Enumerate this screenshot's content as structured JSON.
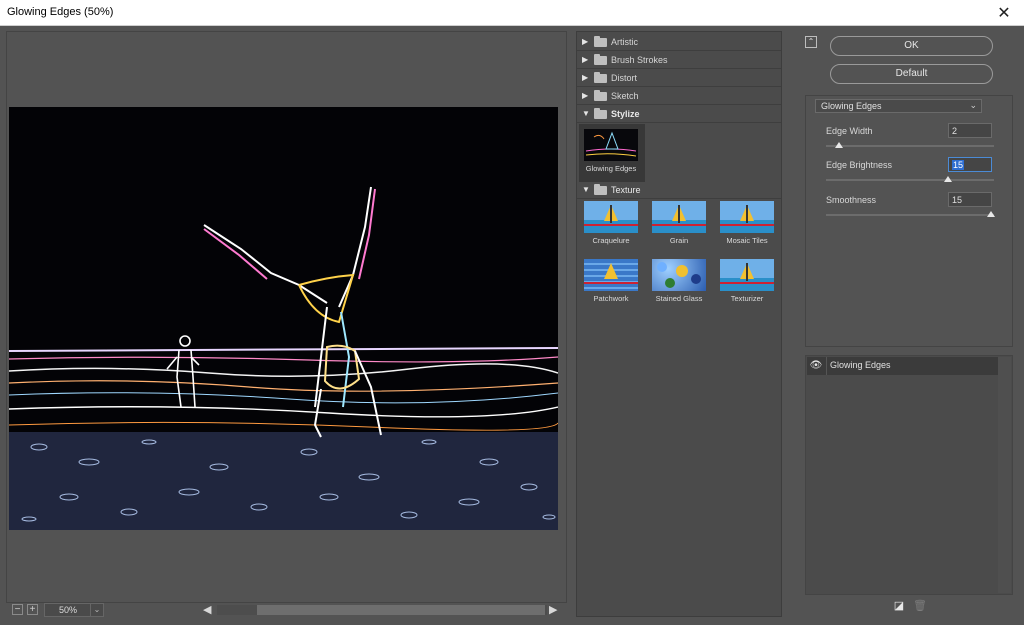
{
  "window": {
    "title": "Glowing Edges (50%)",
    "close_glyph": "✕"
  },
  "preview": {
    "zoom": "50%",
    "zoom_out_glyph": "−",
    "zoom_in_glyph": "+",
    "dropdown_glyph": "⌄",
    "scroll_left_glyph": "◀",
    "scroll_right_glyph": "▶"
  },
  "gallery": {
    "categories": [
      {
        "label": "Artistic",
        "expanded": false,
        "glyph": "▶"
      },
      {
        "label": "Brush Strokes",
        "expanded": false,
        "glyph": "▶"
      },
      {
        "label": "Distort",
        "expanded": false,
        "glyph": "▶"
      },
      {
        "label": "Sketch",
        "expanded": false,
        "glyph": "▶"
      },
      {
        "label": "Stylize",
        "expanded": true,
        "glyph": "▼"
      },
      {
        "label": "Texture",
        "expanded": true,
        "glyph": "▼"
      }
    ],
    "stylize_filters": [
      {
        "label": "Glowing Edges",
        "selected": true
      }
    ],
    "texture_filters": [
      {
        "label": "Craquelure"
      },
      {
        "label": "Grain"
      },
      {
        "label": "Mosaic Tiles"
      },
      {
        "label": "Patchwork"
      },
      {
        "label": "Stained Glass"
      },
      {
        "label": "Texturizer"
      }
    ]
  },
  "actions": {
    "ok_label": "OK",
    "default_label": "Default",
    "collapse_glyph": "⌃"
  },
  "settings": {
    "filter_select": "Glowing Edges",
    "dropdown_glyph": "⌄",
    "params": [
      {
        "label": "Edge Width",
        "value": "2",
        "slider_fraction": 0.08
      },
      {
        "label": "Edge Brightness",
        "value": "15",
        "slider_fraction": 0.73,
        "focused": true
      },
      {
        "label": "Smoothness",
        "value": "15",
        "slider_fraction": 1.0
      }
    ]
  },
  "layers": {
    "items": [
      {
        "label": "Glowing Edges",
        "visible": true,
        "eye_glyph": "👁"
      }
    ],
    "new_layer_glyph": "◪",
    "delete_layer_glyph": "🗑"
  },
  "colors": {
    "panel": "#535353",
    "dark_panel": "#4b4b4b",
    "focus": "#2f6ed1"
  }
}
